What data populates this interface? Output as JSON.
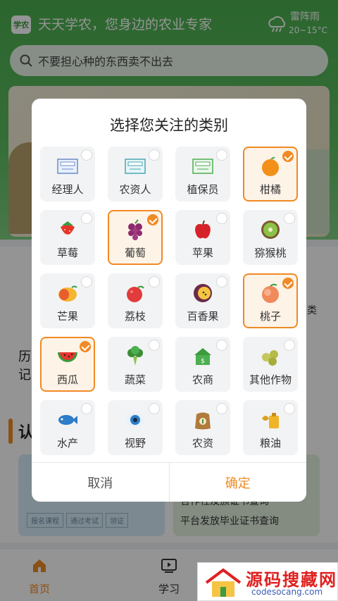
{
  "header": {
    "logo": "学农",
    "slogan": "天天学农，您身边的农业专家",
    "weather": {
      "condition": "雷阵雨",
      "temperature": "20~15°C",
      "icon": "cloud-rain-icon"
    }
  },
  "search": {
    "placeholder": "不要担心种的东西卖不出去"
  },
  "background": {
    "side_text_left": "历\n记",
    "side_text_right": "类",
    "section_title": "认",
    "course_steps": [
      "报名课程",
      "通过考试",
      "领证"
    ],
    "cert_line1": "合作社及颁证书查询",
    "cert_line2": "平台发放毕业证书查询"
  },
  "tabbar": {
    "items": [
      {
        "label": "首页",
        "active": true
      },
      {
        "label": "学习",
        "active": false
      }
    ]
  },
  "watermark": {
    "title": "源码搜藏网",
    "url": "codesocang.com"
  },
  "dialog": {
    "title": "选择您关注的类别",
    "cancel_label": "取消",
    "confirm_label": "确定",
    "categories": [
      {
        "label": "经理人",
        "selected": false,
        "icon": "manager-cert-icon"
      },
      {
        "label": "农资人",
        "selected": false,
        "icon": "agri-supply-cert-icon"
      },
      {
        "label": "植保员",
        "selected": false,
        "icon": "plant-protection-cert-icon"
      },
      {
        "label": "柑橘",
        "selected": true,
        "icon": "orange-icon"
      },
      {
        "label": "草莓",
        "selected": false,
        "icon": "strawberry-icon"
      },
      {
        "label": "葡萄",
        "selected": true,
        "icon": "grape-icon"
      },
      {
        "label": "苹果",
        "selected": false,
        "icon": "apple-icon"
      },
      {
        "label": "猕猴桃",
        "selected": false,
        "icon": "kiwi-icon"
      },
      {
        "label": "芒果",
        "selected": false,
        "icon": "mango-icon"
      },
      {
        "label": "荔枝",
        "selected": false,
        "icon": "lychee-icon"
      },
      {
        "label": "百香果",
        "selected": false,
        "icon": "passion-fruit-icon"
      },
      {
        "label": "桃子",
        "selected": true,
        "icon": "peach-icon"
      },
      {
        "label": "西瓜",
        "selected": true,
        "icon": "watermelon-icon"
      },
      {
        "label": "蔬菜",
        "selected": false,
        "icon": "broccoli-icon"
      },
      {
        "label": "农商",
        "selected": false,
        "icon": "shop-icon"
      },
      {
        "label": "其他作物",
        "selected": false,
        "icon": "other-crops-icon"
      },
      {
        "label": "水产",
        "selected": false,
        "icon": "fish-icon"
      },
      {
        "label": "视野",
        "selected": false,
        "icon": "eye-icon"
      },
      {
        "label": "农资",
        "selected": false,
        "icon": "fertilizer-bag-icon"
      },
      {
        "label": "粮油",
        "selected": false,
        "icon": "grain-oil-icon"
      }
    ]
  },
  "colors": {
    "accent": "#f08a24",
    "green": "#4caf50"
  }
}
